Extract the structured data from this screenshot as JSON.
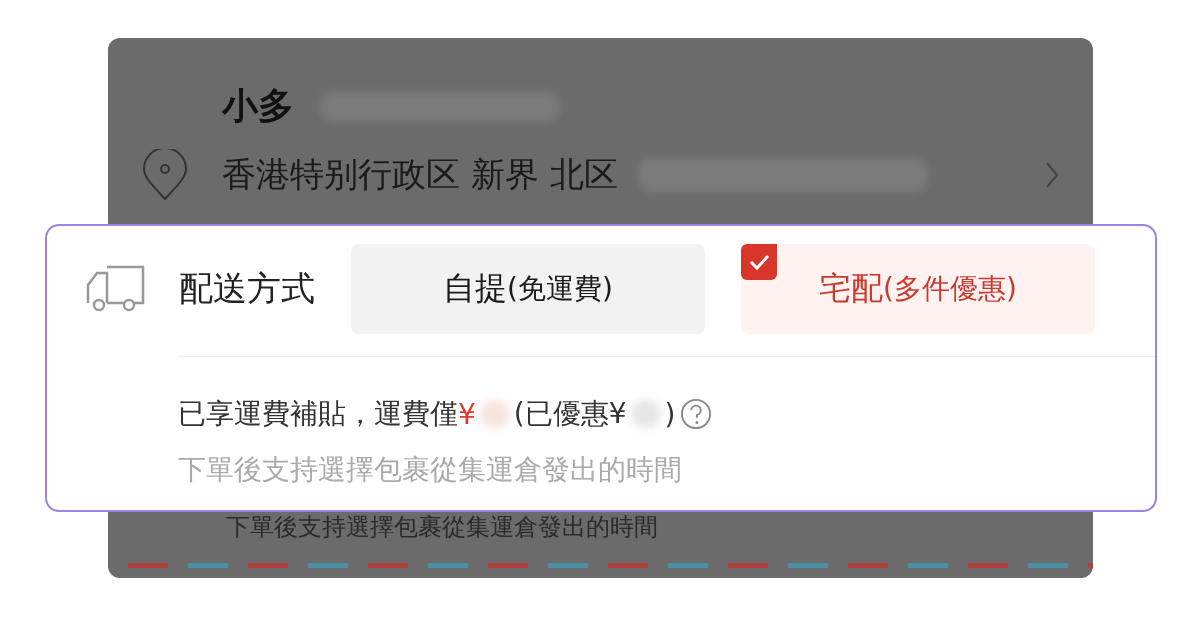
{
  "address_card": {
    "name": "小多",
    "address": "香港特别行政区 新界 北区",
    "note": "下單後支持選擇包裹從集運倉發出的時間"
  },
  "delivery": {
    "label": "配送方式",
    "options": [
      {
        "label": "自提",
        "note": "(免運費)",
        "selected": false
      },
      {
        "label": "宅配",
        "note": "(多件優惠)",
        "selected": true
      }
    ],
    "fee_prefix": "已享運費補貼，運費僅",
    "fee_currency": "¥",
    "fee_saved_prefix": "(已優惠¥",
    "fee_saved_suffix": ")",
    "hint": "下單後支持選擇包裹從集運倉發出的時間"
  }
}
